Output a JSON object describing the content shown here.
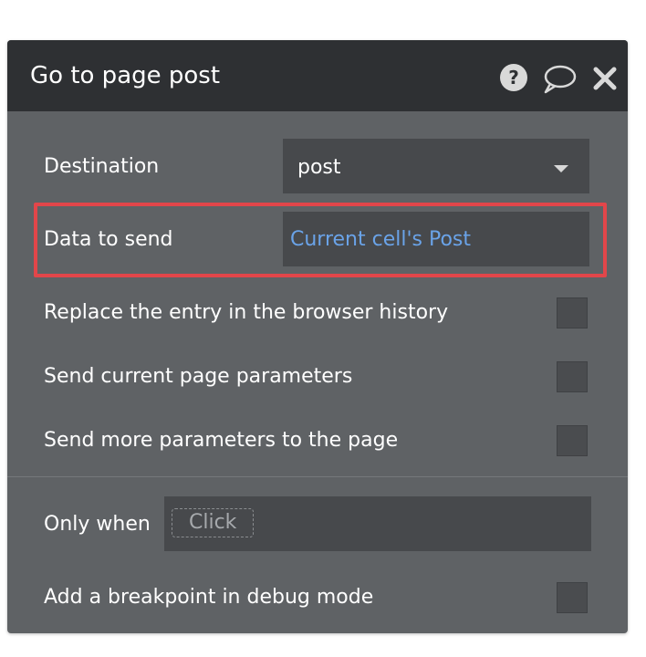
{
  "dialog": {
    "title": "Go to page post",
    "header_icons": [
      "help-icon",
      "comment-icon",
      "close-icon"
    ]
  },
  "fields": {
    "destination": {
      "label": "Destination",
      "value": "post"
    },
    "data_to_send": {
      "label": "Data to send",
      "value": "Current cell's Post"
    },
    "replace_history": {
      "label": "Replace the entry in the browser history",
      "checked": false
    },
    "send_current_params": {
      "label": "Send current page parameters",
      "checked": false
    },
    "send_more_params": {
      "label": "Send more parameters to the page",
      "checked": false
    },
    "only_when": {
      "label": "Only when",
      "placeholder": "Click"
    },
    "breakpoint": {
      "label": "Add a breakpoint in debug mode",
      "checked": false
    }
  },
  "colors": {
    "header_bg": "#2e3033",
    "panel_bg": "#5f6265",
    "field_bg": "#47494c",
    "link_blue": "#6aa3e8",
    "highlight_red": "#e2464a"
  }
}
